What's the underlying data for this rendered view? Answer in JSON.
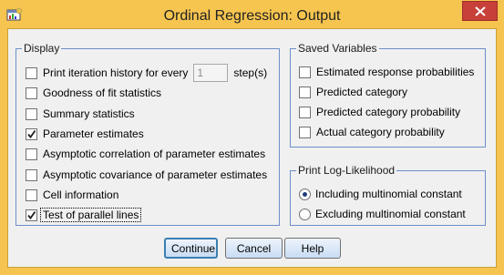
{
  "window": {
    "title": "Ordinal Regression: Output",
    "accent_color": "#f6c54f",
    "close_color": "#c7403a"
  },
  "display": {
    "legend": "Display",
    "items": [
      {
        "label": "Print iteration history for every",
        "checked": false,
        "input_value": "1",
        "suffix": "step(s)"
      },
      {
        "label": "Goodness of fit statistics",
        "checked": false
      },
      {
        "label": "Summary statistics",
        "checked": false
      },
      {
        "label": "Parameter estimates",
        "checked": true
      },
      {
        "label": "Asymptotic correlation of parameter estimates",
        "checked": false
      },
      {
        "label": "Asymptotic covariance of parameter estimates",
        "checked": false
      },
      {
        "label": "Cell information",
        "checked": false
      },
      {
        "label": "Test of parallel lines",
        "checked": true
      }
    ]
  },
  "saved": {
    "legend": "Saved Variables",
    "items": [
      {
        "label": "Estimated response probabilities",
        "checked": false
      },
      {
        "label": "Predicted category",
        "checked": false
      },
      {
        "label": "Predicted category probability",
        "checked": false
      },
      {
        "label": "Actual category probability",
        "checked": false
      }
    ]
  },
  "loglik": {
    "legend": "Print Log-Likelihood",
    "options": [
      {
        "label": "Including multinomial constant",
        "selected": true
      },
      {
        "label": "Excluding multinomial constant",
        "selected": false
      }
    ]
  },
  "buttons": {
    "continue": "Continue",
    "cancel": "Cancel",
    "help": "Help"
  }
}
